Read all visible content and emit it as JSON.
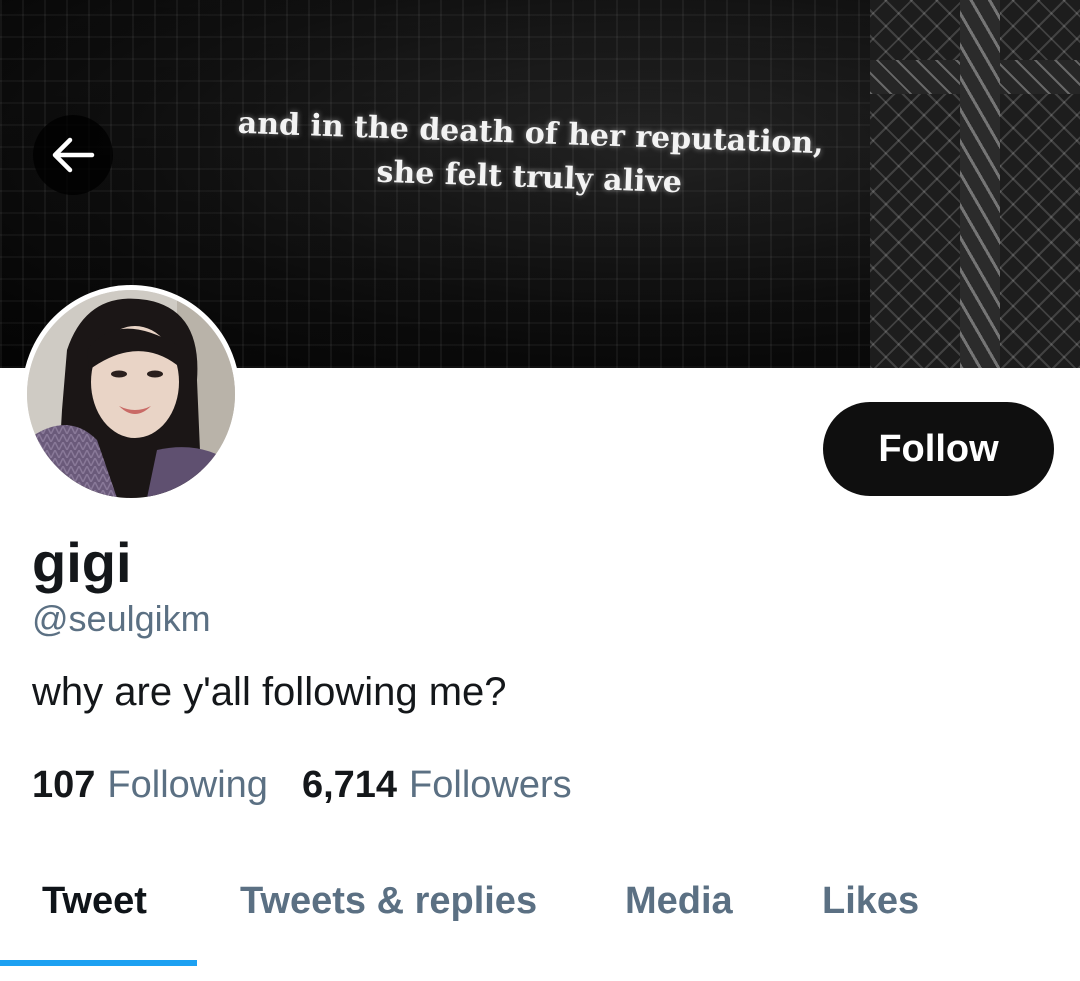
{
  "header": {
    "banner_text_line1": "and in the death of her reputation,",
    "banner_text_line2": "she felt truly alive",
    "back_icon": "arrow-left-icon"
  },
  "profile": {
    "name": "gigi",
    "handle": "@seulgikm",
    "bio": "why are y'all following me?",
    "follow_label": "Follow"
  },
  "stats": {
    "following_count": "107",
    "following_label": "Following",
    "followers_count": "6,714",
    "followers_label": "Followers"
  },
  "tabs": [
    {
      "label": "Tweet",
      "active": true
    },
    {
      "label": "Tweets & replies",
      "active": false
    },
    {
      "label": "Media",
      "active": false
    },
    {
      "label": "Likes",
      "active": false
    }
  ],
  "colors": {
    "accent": "#1da1f2",
    "secondary_text": "#5b7083",
    "primary_text": "#14171a",
    "button_bg": "#0f0f0f"
  }
}
